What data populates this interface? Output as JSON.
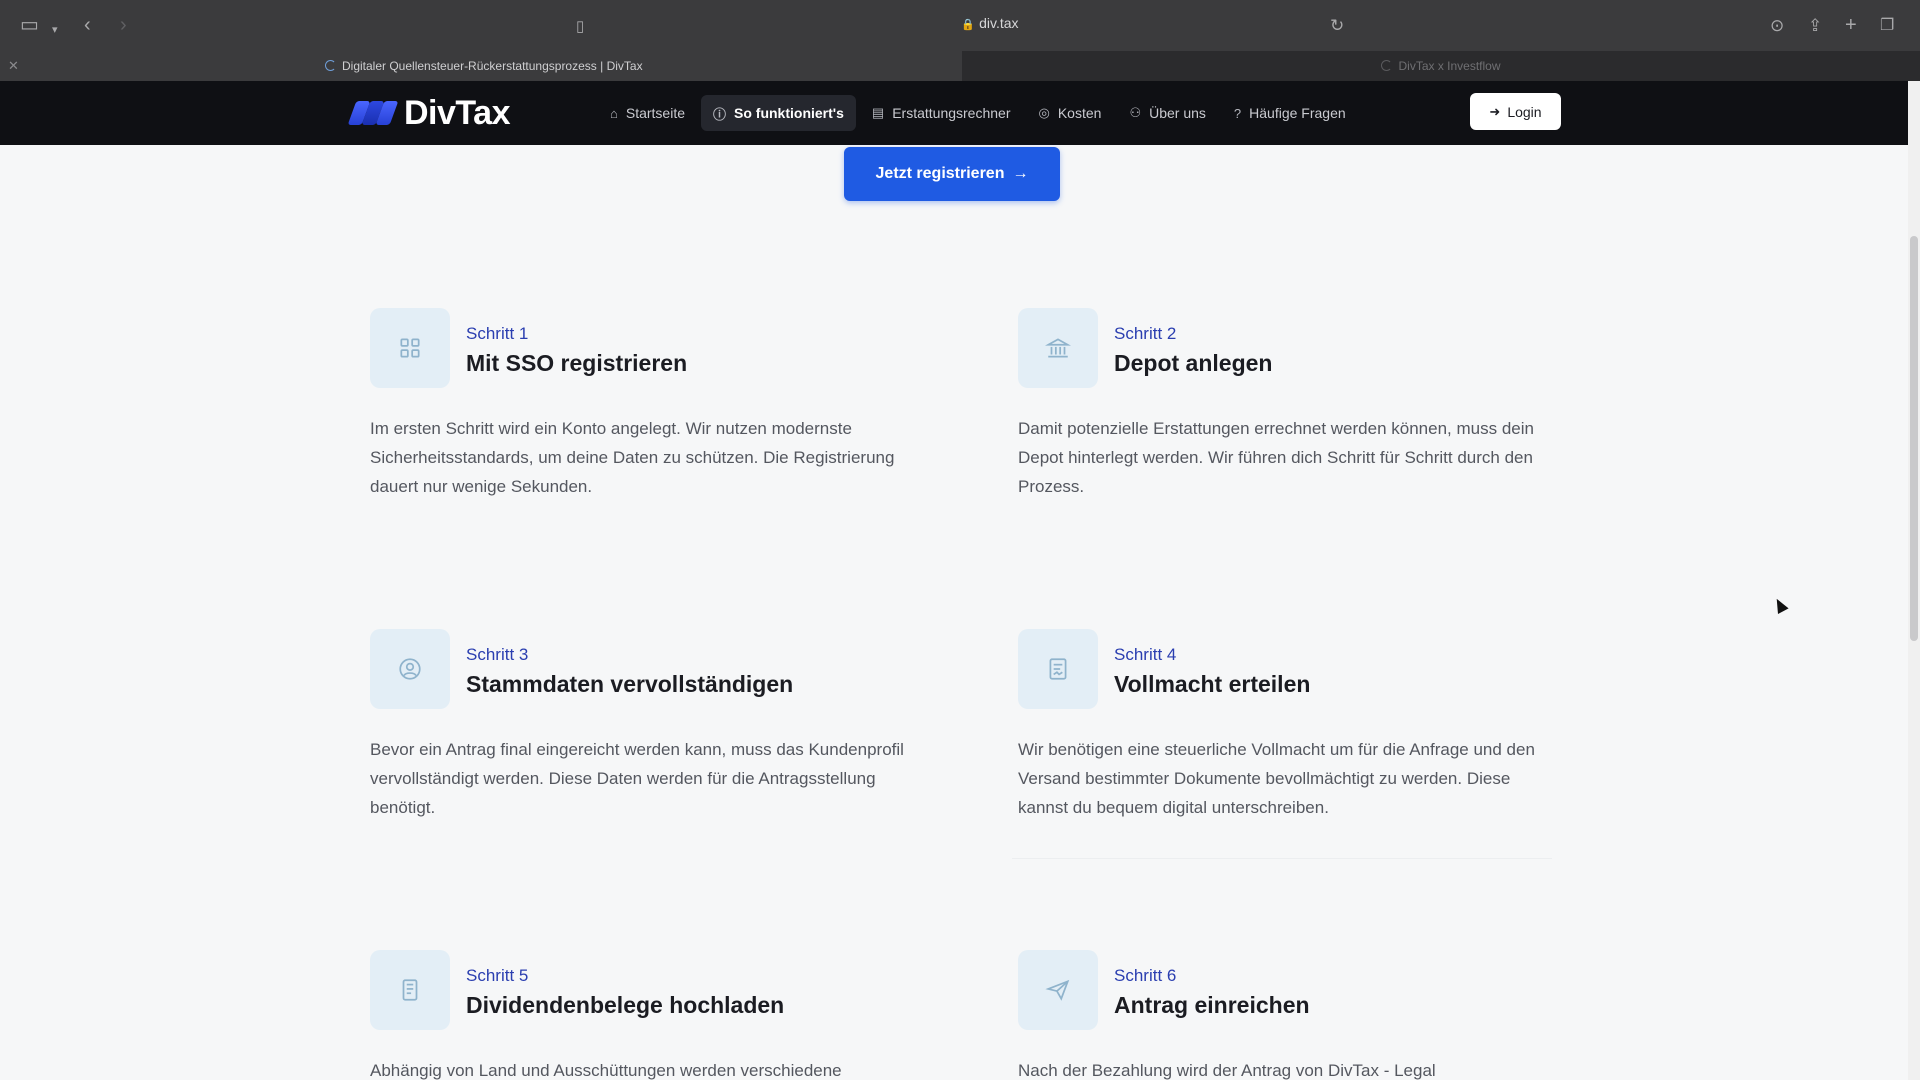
{
  "browser": {
    "url": "div.tax",
    "tabs": [
      {
        "title": "Digitaler Quellensteuer-Rückerstattungsprozess | DivTax"
      },
      {
        "title": "DivTax x Investflow"
      }
    ]
  },
  "header": {
    "logo_text": "DivTax",
    "nav": [
      {
        "label": "Startseite",
        "icon": "home-icon"
      },
      {
        "label": "So funktioniert's",
        "icon": "info-icon"
      },
      {
        "label": "Erstattungsrechner",
        "icon": "calculator-icon"
      },
      {
        "label": "Kosten",
        "icon": "coins-icon"
      },
      {
        "label": "Über uns",
        "icon": "users-icon"
      },
      {
        "label": "Häufige Fragen",
        "icon": "question-icon"
      }
    ],
    "login_label": "Login"
  },
  "main": {
    "cta_label": "Jetzt registrieren",
    "steps": [
      {
        "number": "Schritt 1",
        "title": "Mit SSO registrieren",
        "text": "Im ersten Schritt wird ein Konto angelegt. Wir nutzen modernste Sicherheitsstandards, um deine Daten zu schützen. Die Registrierung dauert nur wenige Sekunden.",
        "icon": "grid-icon"
      },
      {
        "number": "Schritt 2",
        "title": "Depot anlegen",
        "text": "Damit potenzielle Erstattungen errechnet werden können, muss dein Depot hinterlegt werden. Wir führen dich Schritt für Schritt durch den Prozess.",
        "icon": "bank-icon"
      },
      {
        "number": "Schritt 3",
        "title": "Stammdaten vervollständigen",
        "text": "Bevor ein Antrag final eingereicht werden kann, muss das Kundenprofil vervollständigt werden. Diese Daten werden für die Antragsstellung benötigt.",
        "icon": "user-icon"
      },
      {
        "number": "Schritt 4",
        "title": "Vollmacht erteilen",
        "text": "Wir benötigen eine steuerliche Vollmacht um für die Anfrage und den Versand bestimmter Dokumente bevollmächtigt zu werden. Diese kannst du bequem digital unterschreiben.",
        "icon": "document-sign-icon"
      },
      {
        "number": "Schritt 5",
        "title": "Dividendenbelege hochladen",
        "text": "Abhängig von Land und Ausschüttungen werden verschiedene",
        "icon": "file-upload-icon"
      },
      {
        "number": "Schritt 6",
        "title": "Antrag einreichen",
        "text": "Nach der Bezahlung wird der Antrag von DivTax - Legal",
        "icon": "send-icon"
      }
    ]
  },
  "colors": {
    "accent": "#1f5be3",
    "nav_bg": "#0f1014",
    "step_label": "#2a3eb0",
    "icon_tile": "#e3eef6"
  }
}
